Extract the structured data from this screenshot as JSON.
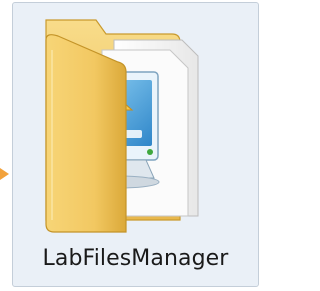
{
  "item": {
    "name": "LabFilesManager",
    "icon": "folder-with-application-icon",
    "selected": true
  },
  "colors": {
    "selection_fill": "#eaf0f7",
    "selection_border": "#c4ced9",
    "folder_yellow": "#f3cc67",
    "folder_dark": "#dba939",
    "accent_arrow": "#f2a23c"
  }
}
